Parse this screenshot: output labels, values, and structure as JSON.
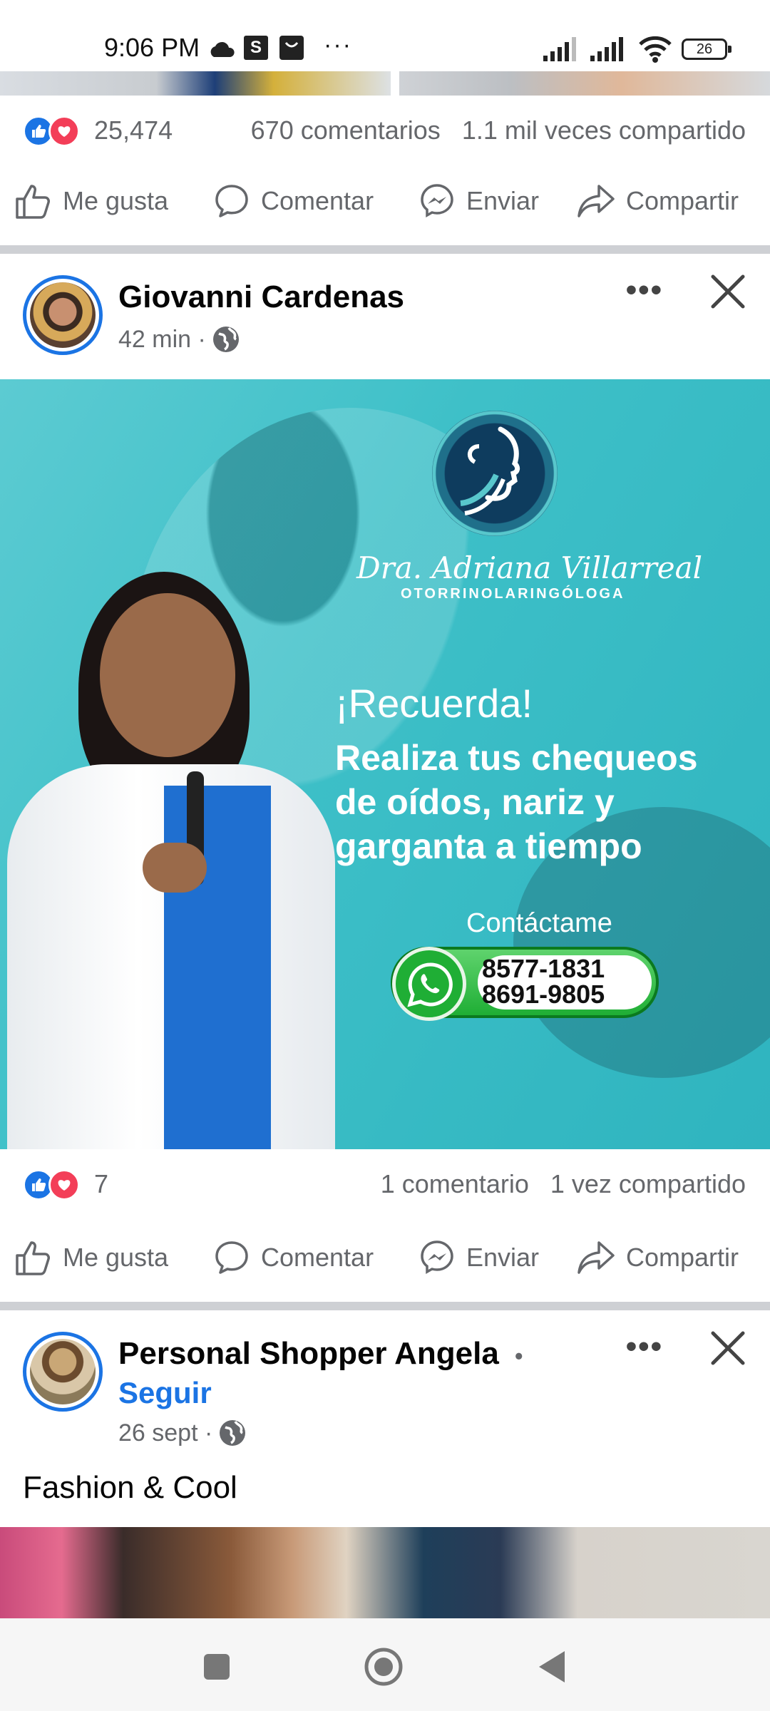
{
  "status_bar": {
    "time": "9:06 PM",
    "icons": [
      "cloud-icon",
      "s-app-icon",
      "shopping-bag-icon",
      "more-notifications-icon",
      "signal-icon",
      "signal-icon",
      "wifi-icon",
      "battery-icon"
    ],
    "more": "···",
    "s_label": "S",
    "battery": "26"
  },
  "prev_post": {
    "reactions_count": "25,474",
    "comments": "670 comentarios",
    "shares": "1.1 mil veces compartido"
  },
  "actions": {
    "like": "Me gusta",
    "comment": "Comentar",
    "send": "Enviar",
    "share": "Compartir"
  },
  "post1": {
    "author": "Giovanni Cardenas",
    "time": "42 min ·",
    "ad": {
      "doctor_name": "Dra. Adriana Villarreal",
      "specialty": "OTORRINOLARINGÓLOGA",
      "headline": "¡Recuerda!",
      "body": "Realiza tus chequeos de oídos, nariz y garganta a tiempo",
      "contact_label": "Contáctame",
      "phone1": "8577-1831",
      "phone2": "8691-9805"
    },
    "reactions_count": "7",
    "comments": "1 comentario",
    "shares": "1 vez compartido"
  },
  "post2": {
    "author": "Personal Shopper Angela",
    "separator": "•",
    "follow": "Seguir",
    "time": "26 sept ·",
    "text": "Fashion & Cool"
  },
  "colors": {
    "facebook_blue": "#1b74e4",
    "love_red": "#f33e58",
    "secondary_text": "#65676b",
    "ad_teal": "#3ec0c8",
    "whatsapp_green": "#1fae35"
  }
}
